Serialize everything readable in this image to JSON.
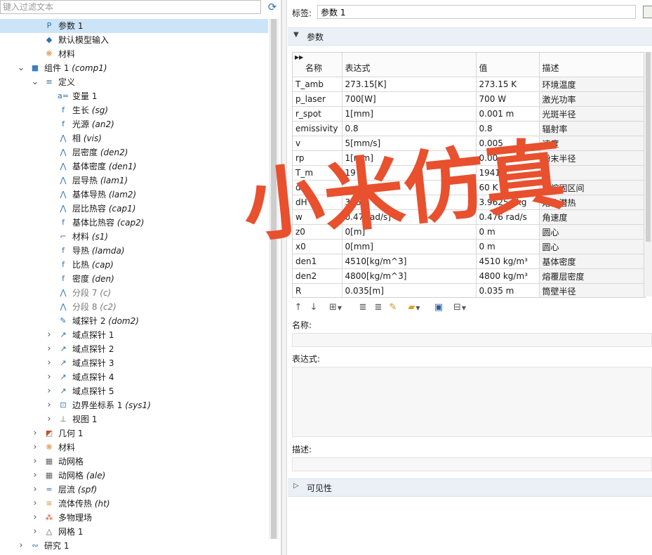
{
  "filter": {
    "placeholder": "键入过滤文本"
  },
  "tree": [
    {
      "label": "参数 1",
      "it": "",
      "depth": 2,
      "toggle": "",
      "icon": "param-icon",
      "selected": true,
      "gray": false
    },
    {
      "label": "默认模型输入",
      "it": "",
      "depth": 2,
      "toggle": "",
      "icon": "model-input-icon",
      "selected": false,
      "gray": false
    },
    {
      "label": "材料",
      "it": "",
      "depth": 2,
      "toggle": "",
      "icon": "material-icon",
      "selected": false,
      "gray": false
    },
    {
      "label": "组件 1 ",
      "it": "(comp1)",
      "depth": 1,
      "toggle": "v",
      "icon": "component-icon",
      "selected": false,
      "gray": false
    },
    {
      "label": "定义",
      "it": "",
      "depth": 2,
      "toggle": "v",
      "icon": "definitions-icon",
      "selected": false,
      "gray": false
    },
    {
      "label": "变量 1",
      "it": "",
      "depth": 3,
      "toggle": "",
      "icon": "variable-icon",
      "selected": false,
      "gray": false
    },
    {
      "label": "生长 ",
      "it": "(sg)",
      "depth": 3,
      "toggle": "",
      "icon": "function-icon",
      "selected": false,
      "gray": false
    },
    {
      "label": "光源 ",
      "it": "(an2)",
      "depth": 3,
      "toggle": "",
      "icon": "function-icon",
      "selected": false,
      "gray": false
    },
    {
      "label": "相 ",
      "it": "(vis)",
      "depth": 3,
      "toggle": "",
      "icon": "piecewise-icon",
      "selected": false,
      "gray": false
    },
    {
      "label": "层密度 ",
      "it": "(den2)",
      "depth": 3,
      "toggle": "",
      "icon": "piecewise-icon",
      "selected": false,
      "gray": false
    },
    {
      "label": "基体密度 ",
      "it": "(den1)",
      "depth": 3,
      "toggle": "",
      "icon": "piecewise-icon",
      "selected": false,
      "gray": false
    },
    {
      "label": "层导热 ",
      "it": "(lam1)",
      "depth": 3,
      "toggle": "",
      "icon": "piecewise-icon",
      "selected": false,
      "gray": false
    },
    {
      "label": "基体导热 ",
      "it": "(lam2)",
      "depth": 3,
      "toggle": "",
      "icon": "piecewise-icon",
      "selected": false,
      "gray": false
    },
    {
      "label": "层比热容 ",
      "it": "(cap1)",
      "depth": 3,
      "toggle": "",
      "icon": "piecewise-icon",
      "selected": false,
      "gray": false
    },
    {
      "label": "基体比热容 ",
      "it": "(cap2)",
      "depth": 3,
      "toggle": "",
      "icon": "function-icon",
      "selected": false,
      "gray": false
    },
    {
      "label": "材料 ",
      "it": "(s1)",
      "depth": 3,
      "toggle": "",
      "icon": "step-icon",
      "selected": false,
      "gray": false
    },
    {
      "label": "导热 ",
      "it": "(lamda)",
      "depth": 3,
      "toggle": "",
      "icon": "function-icon",
      "selected": false,
      "gray": false
    },
    {
      "label": "比热 ",
      "it": "(cap)",
      "depth": 3,
      "toggle": "",
      "icon": "function-icon",
      "selected": false,
      "gray": false
    },
    {
      "label": "密度 ",
      "it": "(den)",
      "depth": 3,
      "toggle": "",
      "icon": "function-icon",
      "selected": false,
      "gray": false
    },
    {
      "label": "分段 7 ",
      "it": "(c)",
      "depth": 3,
      "toggle": "",
      "icon": "piecewise-icon",
      "selected": false,
      "gray": true
    },
    {
      "label": "分段 8 ",
      "it": "(c2)",
      "depth": 3,
      "toggle": "",
      "icon": "piecewise-icon",
      "selected": false,
      "gray": true
    },
    {
      "label": "域探针 2 ",
      "it": "(dom2)",
      "depth": 3,
      "toggle": "",
      "icon": "probe-icon",
      "selected": false,
      "gray": false
    },
    {
      "label": "域点探针 1",
      "it": "",
      "depth": 3,
      "toggle": ">",
      "icon": "point-probe-icon",
      "selected": false,
      "gray": false
    },
    {
      "label": "域点探针 2",
      "it": "",
      "depth": 3,
      "toggle": ">",
      "icon": "point-probe-icon",
      "selected": false,
      "gray": false
    },
    {
      "label": "域点探针 3",
      "it": "",
      "depth": 3,
      "toggle": ">",
      "icon": "point-probe-icon",
      "selected": false,
      "gray": false
    },
    {
      "label": "域点探针 4",
      "it": "",
      "depth": 3,
      "toggle": ">",
      "icon": "point-probe-icon",
      "selected": false,
      "gray": false
    },
    {
      "label": "域点探针 5",
      "it": "",
      "depth": 3,
      "toggle": ">",
      "icon": "point-probe-icon",
      "selected": false,
      "gray": false
    },
    {
      "label": "边界坐标系 1 ",
      "it": "(sys1)",
      "depth": 3,
      "toggle": ">",
      "icon": "coordinate-system-icon",
      "selected": false,
      "gray": false
    },
    {
      "label": "视图 1",
      "it": "",
      "depth": 3,
      "toggle": ">",
      "icon": "view-icon",
      "selected": false,
      "gray": false
    },
    {
      "label": "几何 1",
      "it": "",
      "depth": 2,
      "toggle": ">",
      "icon": "geometry-icon",
      "selected": false,
      "gray": false
    },
    {
      "label": "材料",
      "it": "",
      "depth": 2,
      "toggle": ">",
      "icon": "material-icon",
      "selected": false,
      "gray": false
    },
    {
      "label": "动网格",
      "it": "",
      "depth": 2,
      "toggle": ">",
      "icon": "moving-mesh-icon",
      "selected": false,
      "gray": false
    },
    {
      "label": "动网格 ",
      "it": "(ale)",
      "depth": 2,
      "toggle": ">",
      "icon": "moving-mesh-icon",
      "selected": false,
      "gray": false
    },
    {
      "label": "层流 ",
      "it": "(spf)",
      "depth": 2,
      "toggle": ">",
      "icon": "laminar-flow-icon",
      "selected": false,
      "gray": false
    },
    {
      "label": "流体传热 ",
      "it": "(ht)",
      "depth": 2,
      "toggle": ">",
      "icon": "heat-transfer-icon",
      "selected": false,
      "gray": false
    },
    {
      "label": "多物理场",
      "it": "",
      "depth": 2,
      "toggle": ">",
      "icon": "multiphysics-icon",
      "selected": false,
      "gray": false
    },
    {
      "label": "网格 1",
      "it": "",
      "depth": 2,
      "toggle": ">",
      "icon": "mesh-icon",
      "selected": false,
      "gray": false
    },
    {
      "label": "研究 1",
      "it": "",
      "depth": 1,
      "toggle": ">",
      "icon": "study-icon",
      "selected": false,
      "gray": false
    }
  ],
  "settings": {
    "label_caption": "标签:",
    "label_value": "参数 1",
    "params_section": "参数",
    "visibility_section": "可见性",
    "name_caption": "名称:",
    "expr_caption": "表达式:",
    "desc_caption": "描述:"
  },
  "table": {
    "headers": [
      "名称",
      "表达式",
      "值",
      "描述"
    ],
    "rows": [
      [
        "T_amb",
        "273.15[K]",
        "273.15 K",
        "环境温度"
      ],
      [
        "p_laser",
        "700[W]",
        "700 W",
        "激光功率"
      ],
      [
        "r_spot",
        "1[mm]",
        "0.001 m",
        "光斑半径"
      ],
      [
        "emissivity",
        "0.8",
        "0.8",
        "辐射率"
      ],
      [
        "v",
        "5[mm/s]",
        "0.005",
        "速度"
      ],
      [
        "rp",
        "1[mm]",
        "0.00",
        "粉末半径"
      ],
      [
        "T_m",
        "19",
        "1941",
        ""
      ],
      [
        "d",
        "",
        "60 K",
        "半熔固区间"
      ],
      [
        "dH",
        "396",
        "3.9625 J/kg",
        "熔化潜热"
      ],
      [
        "w",
        "0.47 rad/s]",
        "0.476 rad/s",
        "角速度"
      ],
      [
        "z0",
        "0[m]",
        "0 m",
        "圆心"
      ],
      [
        "x0",
        "0[mm]",
        "0 m",
        "圆心"
      ],
      [
        "den1",
        "4510[kg/m^3]",
        "4510 kg/m³",
        "基体密度"
      ],
      [
        "den2",
        "4800[kg/m^3]",
        "4800 kg/m³",
        "熔覆层密度"
      ],
      [
        "R",
        "0.035[m]",
        "0.035 m",
        "筒壁半径"
      ]
    ]
  },
  "watermark": {
    "text": "小米仿真",
    "color": "#e8502e"
  },
  "colors": {
    "selection": "#cce4f7",
    "section_bg": "#eaf0f6",
    "accent": "#2c6fb0"
  }
}
